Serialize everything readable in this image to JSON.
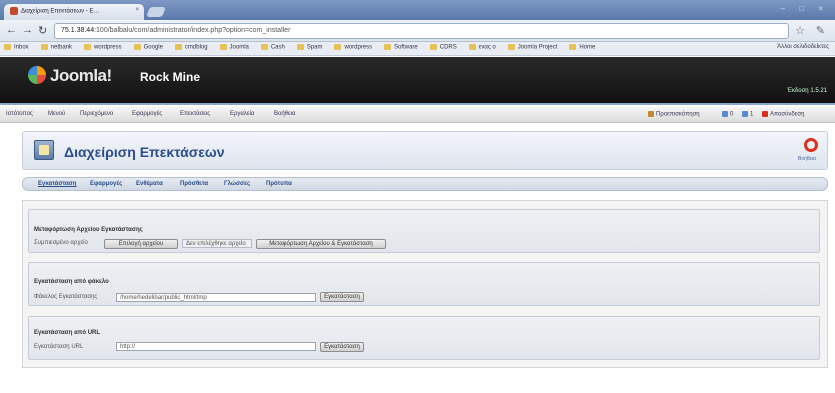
{
  "browser": {
    "tab_title": "Διαχείριση Επεκτάσεων - E…",
    "tab_close": "×",
    "window_controls": "– □ ×",
    "url_host": "75.1.38.44",
    "url_path": ":100/balbalu/com/administrator/index.php?option=com_installer",
    "bookmarks": [
      "Inbox",
      "netbank",
      "wordpress",
      "Google",
      "cmdblog",
      "Joomla",
      "Cash",
      "Spam",
      "wordpress",
      "Software",
      "CDRS",
      "ενας ο",
      "Joomla Project",
      "Home"
    ],
    "other_bookmarks": "Άλλοι σελιδοδείκτες",
    "icons": [
      "back-icon",
      "forward-icon",
      "reload-icon",
      "star-icon",
      "wrench-icon"
    ]
  },
  "joomla": {
    "logo_text": "Joomla!",
    "site_name": "Rock Mine",
    "version": "Έκδοση 1.5.21",
    "menu": [
      "Ιστότοπος",
      "Μενού",
      "Περιεχόμενο",
      "Εφαρμογές",
      "Επεκτάσεις",
      "Εργαλεία",
      "Βοήθεια"
    ],
    "status": [
      {
        "label": "Προεπισκόπηση",
        "color": "#c08a2e"
      },
      {
        "label": "0",
        "color": "#5a8ad0"
      },
      {
        "label": "1",
        "color": "#5a8ad0"
      },
      {
        "label": "Αποσύνδεση",
        "color": "#d9311e"
      }
    ]
  },
  "page": {
    "title": "Διαχείριση Επεκτάσεων",
    "help_label": "Βοήθεια",
    "subnav": [
      "Εγκατάσταση",
      "Εφαρμογές",
      "Ενθέματα",
      "Πρόσθετα",
      "Γλώσσες",
      "Πρότυπα"
    ],
    "active_subnav_index": 0
  },
  "upload": {
    "title": "Μεταφόρτωση Αρχείου Εγκατάστασης",
    "label": "Συμπιεσμένο αρχείο",
    "choose_button": "Επιλογή αρχείου",
    "no_file_text": "Δεν επιλέχθηκε αρχείο",
    "submit_button": "Μεταφόρτωση Αρχείου & Εγκατάσταση"
  },
  "folder": {
    "title": "Εγκατάσταση από φάκελο",
    "label": "Φάκελος Εγκατάστασης",
    "value": "/home/hedelibar/public_html/tmp",
    "button": "Εγκατάσταση"
  },
  "url_install": {
    "title": "Εγκατάσταση από URL",
    "label": "Εγκατάσταση URL",
    "value": "http://",
    "button": "Εγκατάσταση"
  }
}
